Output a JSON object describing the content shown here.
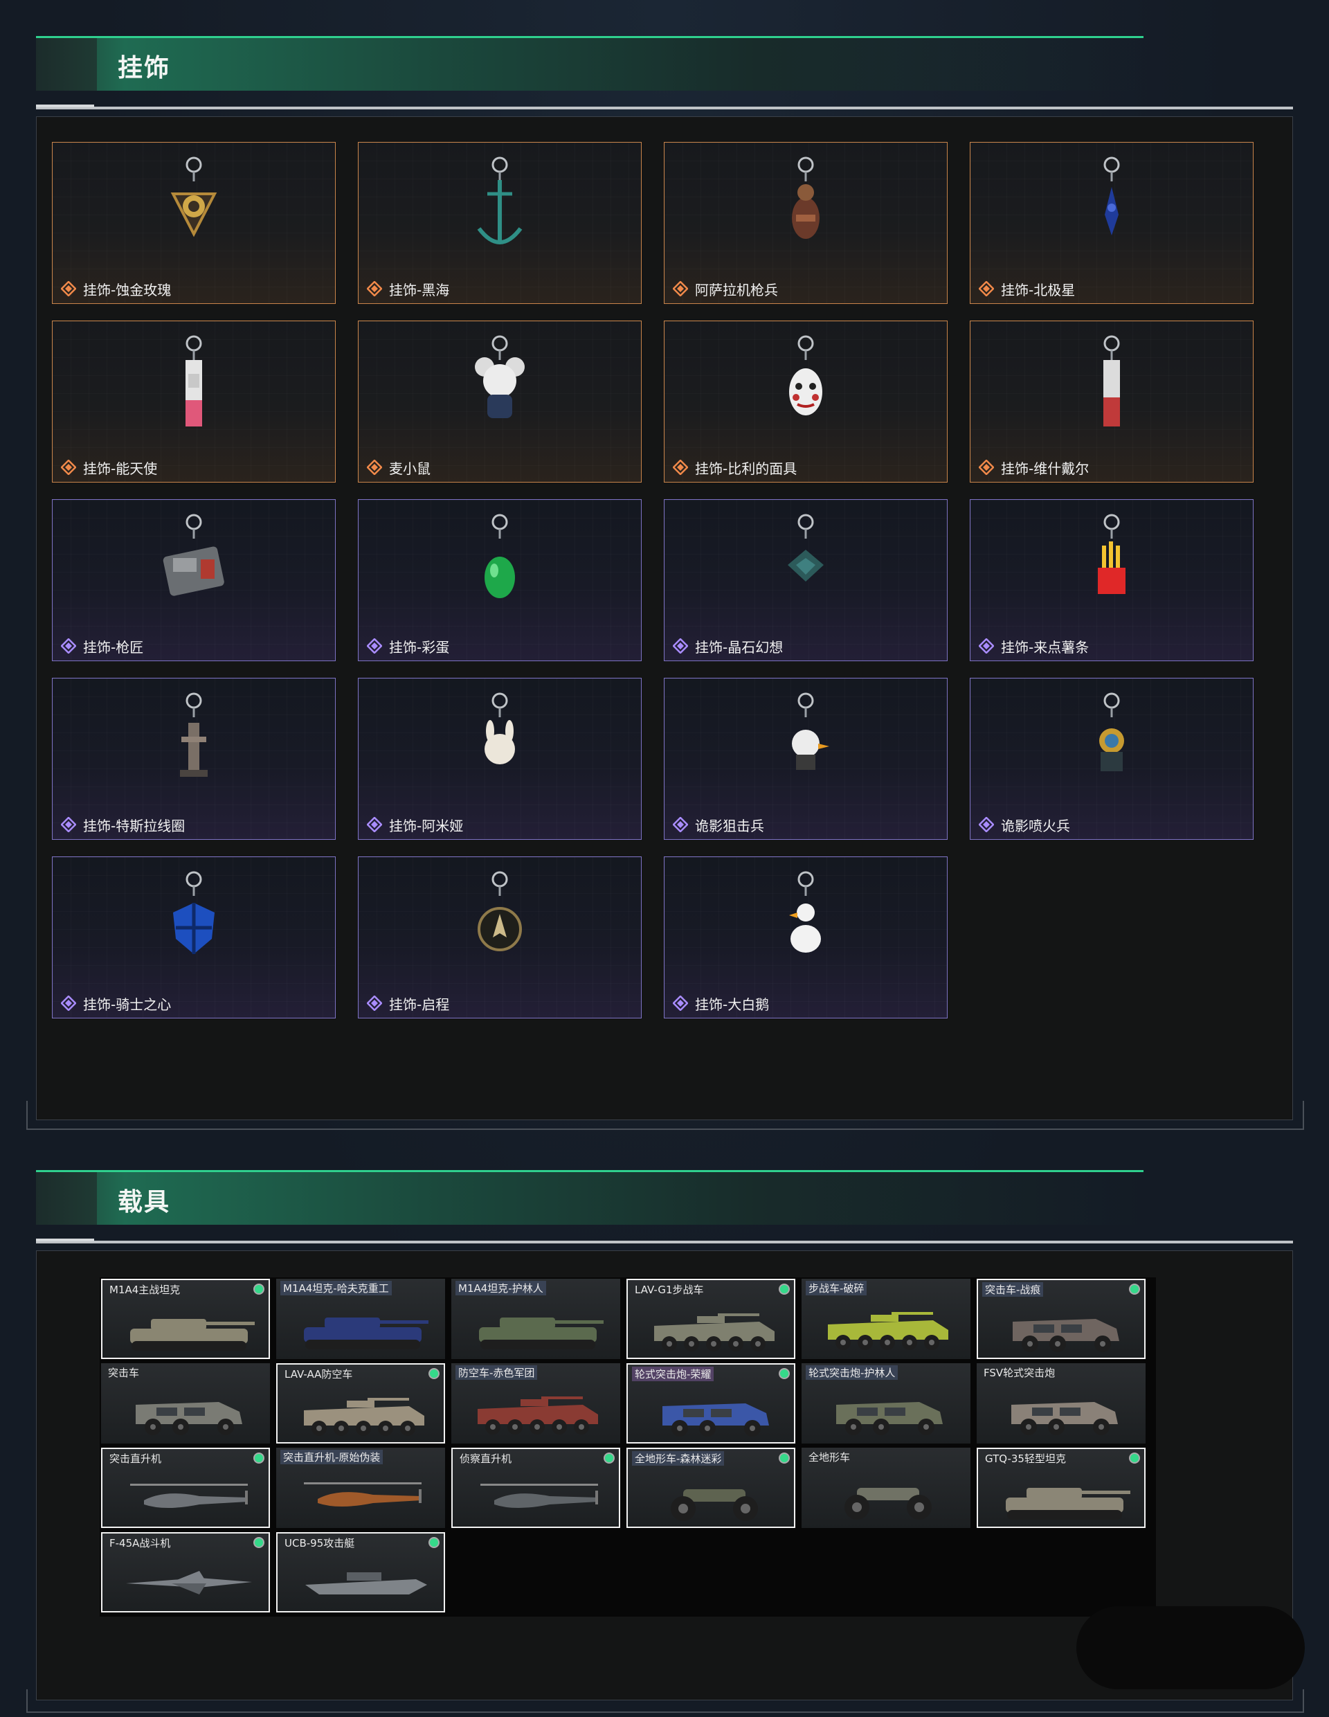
{
  "charms_section": {
    "title": "挂饰",
    "items": [
      {
        "label": "挂饰-蚀金玫瑰",
        "rarity": "gold",
        "icon": "rose-medallion-charm"
      },
      {
        "label": "挂饰-黑海",
        "rarity": "gold",
        "icon": "anchor-charm"
      },
      {
        "label": "阿萨拉机枪兵",
        "rarity": "gold",
        "icon": "soldier-figure-charm"
      },
      {
        "label": "挂饰-北极星",
        "rarity": "gold",
        "icon": "blue-star-charm"
      },
      {
        "label": "挂饰-能天使",
        "rarity": "gold",
        "icon": "pink-tag-charm"
      },
      {
        "label": "麦小鼠",
        "rarity": "gold",
        "icon": "mouse-figure-charm"
      },
      {
        "label": "挂饰-比利的面具",
        "rarity": "gold",
        "icon": "clown-mask-charm"
      },
      {
        "label": "挂饰-维什戴尔",
        "rarity": "gold",
        "icon": "red-tag-charm"
      },
      {
        "label": "挂饰-枪匠",
        "rarity": "purple",
        "icon": "gun-case-charm"
      },
      {
        "label": "挂饰-彩蛋",
        "rarity": "purple",
        "icon": "green-egg-charm"
      },
      {
        "label": "挂饰-晶石幻想",
        "rarity": "purple",
        "icon": "crystal-cube-charm"
      },
      {
        "label": "挂饰-来点薯条",
        "rarity": "purple",
        "icon": "fries-charm"
      },
      {
        "label": "挂饰-特斯拉线圈",
        "rarity": "purple",
        "icon": "tesla-coil-charm"
      },
      {
        "label": "挂饰-阿米娅",
        "rarity": "purple",
        "icon": "rabbit-figure-charm"
      },
      {
        "label": "诡影狙击兵",
        "rarity": "purple",
        "icon": "duck-sniper-charm"
      },
      {
        "label": "诡影喷火兵",
        "rarity": "purple",
        "icon": "diver-figure-charm"
      },
      {
        "label": "挂饰-骑士之心",
        "rarity": "purple",
        "icon": "blue-shield-charm"
      },
      {
        "label": "挂饰-启程",
        "rarity": "purple",
        "icon": "compass-badge-charm"
      },
      {
        "label": "挂饰-大白鹅",
        "rarity": "purple",
        "icon": "white-goose-charm"
      }
    ]
  },
  "vehicles_section": {
    "title": "载具",
    "items": [
      {
        "label": "M1A4主战坦克",
        "selected": true,
        "dot": true,
        "kind": "tank",
        "tint": "#8a8672",
        "tag": "none"
      },
      {
        "label": "M1A4坦克-哈夫克重工",
        "selected": false,
        "dot": false,
        "kind": "tank",
        "tint": "#2b3a7a",
        "tag": "hl"
      },
      {
        "label": "M1A4坦克-护林人",
        "selected": false,
        "dot": false,
        "kind": "tank",
        "tint": "#5b6a4e",
        "tag": "hl"
      },
      {
        "label": "LAV-G1步战车",
        "selected": true,
        "dot": true,
        "kind": "apc",
        "tint": "#7f806f",
        "tag": "none"
      },
      {
        "label": "步战车-破碎",
        "selected": false,
        "dot": false,
        "kind": "apc",
        "tint": "#a8b83a",
        "tag": "hl"
      },
      {
        "label": "突击车-战痕",
        "selected": true,
        "dot": true,
        "kind": "truck",
        "tint": "#6f6560",
        "tag": "hl"
      },
      {
        "label": "突击车",
        "selected": false,
        "dot": false,
        "kind": "truck",
        "tint": "#7a7b74",
        "tag": "none"
      },
      {
        "label": "LAV-AA防空车",
        "selected": true,
        "dot": true,
        "kind": "apc",
        "tint": "#9b917e",
        "tag": "none"
      },
      {
        "label": "防空车-赤色军团",
        "selected": false,
        "dot": false,
        "kind": "apc",
        "tint": "#8a3b33",
        "tag": "hl"
      },
      {
        "label": "轮式突击炮-荣耀",
        "selected": true,
        "dot": true,
        "kind": "truck",
        "tint": "#3b57a8",
        "tag": "pk"
      },
      {
        "label": "轮式突击炮-护林人",
        "selected": false,
        "dot": false,
        "kind": "truck",
        "tint": "#6a705a",
        "tag": "hl"
      },
      {
        "label": "FSV轮式突击炮",
        "selected": false,
        "dot": false,
        "kind": "truck",
        "tint": "#8a8178",
        "tag": "none"
      },
      {
        "label": "突击直升机",
        "selected": true,
        "dot": true,
        "kind": "heli",
        "tint": "#6f7378",
        "tag": "none"
      },
      {
        "label": "突击直升机-原始伪装",
        "selected": false,
        "dot": false,
        "kind": "heli",
        "tint": "#a05a2a",
        "tag": "hl"
      },
      {
        "label": "侦察直升机",
        "selected": true,
        "dot": true,
        "kind": "heli",
        "tint": "#5f6468",
        "tag": "none"
      },
      {
        "label": "全地形车-森林迷彩",
        "selected": true,
        "dot": true,
        "kind": "atv",
        "tint": "#5e6350",
        "tag": "hl"
      },
      {
        "label": "全地形车",
        "selected": false,
        "dot": false,
        "kind": "atv",
        "tint": "#707265",
        "tag": "none"
      },
      {
        "label": "GTQ-35轻型坦克",
        "selected": true,
        "dot": true,
        "kind": "tank",
        "tint": "#8b8676",
        "tag": "none"
      },
      {
        "label": "F-45A战斗机",
        "selected": true,
        "dot": true,
        "kind": "jet",
        "tint": "#7d8288",
        "tag": "none"
      },
      {
        "label": "UCB-95攻击艇",
        "selected": true,
        "dot": true,
        "kind": "boat",
        "tint": "#7f8489",
        "tag": "none"
      }
    ]
  },
  "colors": {
    "gold_border": "#c9844a",
    "purple_border": "#7d72c4",
    "header_accent": "#2fd08e",
    "owned_dot": "#35d98a"
  }
}
